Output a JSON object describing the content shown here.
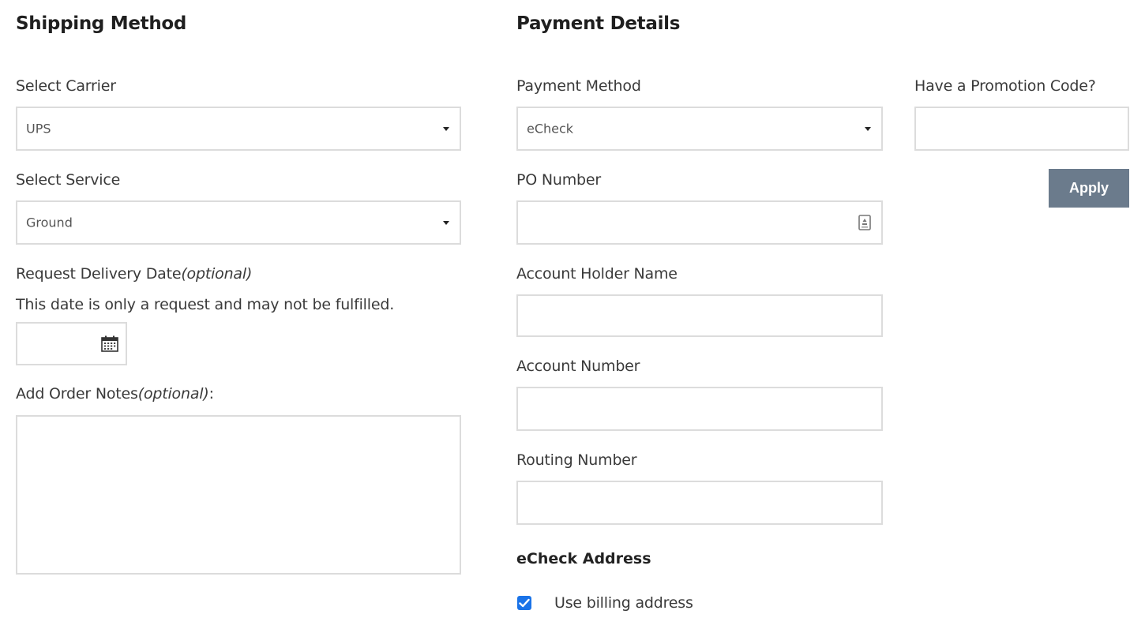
{
  "shipping": {
    "title": "Shipping Method",
    "carrier": {
      "label": "Select Carrier",
      "value": "UPS"
    },
    "service": {
      "label": "Select Service",
      "value": "Ground"
    },
    "delivery_date": {
      "label": "Request Delivery Date",
      "optional": "(optional)",
      "helper": "This date is only a request and may not be fulfilled.",
      "value": ""
    },
    "notes": {
      "label": "Add Order Notes",
      "optional": "(optional)",
      "suffix": ":",
      "value": ""
    }
  },
  "payment": {
    "title": "Payment Details",
    "method": {
      "label": "Payment Method",
      "value": "eCheck"
    },
    "po_number": {
      "label": "PO Number",
      "value": ""
    },
    "account_holder": {
      "label": "Account Holder Name",
      "value": ""
    },
    "account_number": {
      "label": "Account Number",
      "value": ""
    },
    "routing_number": {
      "label": "Routing Number",
      "value": ""
    },
    "echeck_address": {
      "title": "eCheck Address",
      "use_billing": {
        "label": "Use billing address",
        "checked": true
      }
    }
  },
  "promo": {
    "label": "Have a Promotion Code?",
    "value": "",
    "apply_label": "Apply"
  },
  "colors": {
    "apply_button": "#6b7b8c",
    "checkbox": "#1a73e8"
  },
  "icons": {
    "dropdown": "caret-down",
    "calendar": "calendar",
    "po_autofill": "contact-card"
  }
}
